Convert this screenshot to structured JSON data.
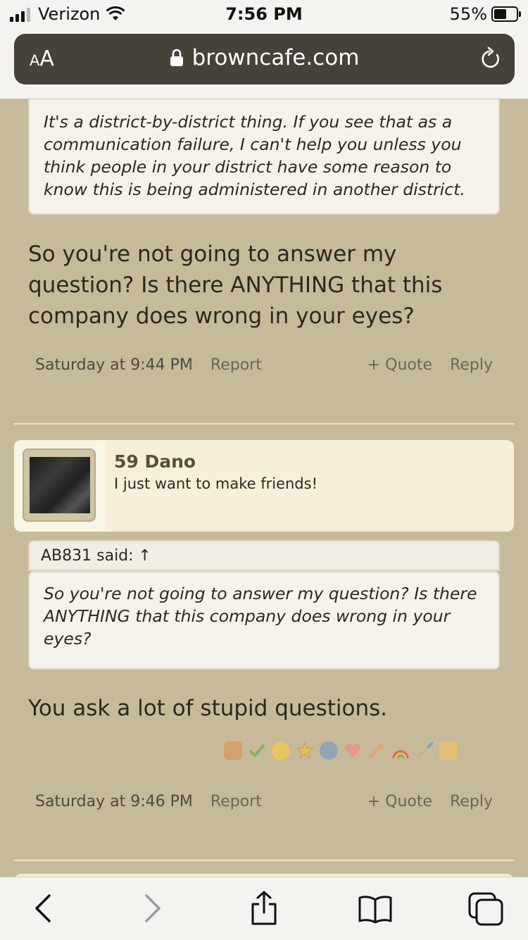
{
  "status_bar": {
    "carrier": "Verizon",
    "time": "7:56 PM",
    "battery": "55%",
    "battery_level": 0.55
  },
  "browser": {
    "text_size_small": "A",
    "text_size_large": "A",
    "url": "browncafe.com"
  },
  "posts": [
    {
      "quote_text": "It's a district-by-district thing. If you see that as a communication failure, I can't help you unless you think people in your district have some reason to know this is being administered in another district.",
      "body": "So you're not going to answer my question? Is there ANYTHING that this company does wrong in your eyes?",
      "timestamp": "Saturday at 9:44 PM",
      "report": "Report",
      "quote": "+ Quote",
      "reply": "Reply"
    },
    {
      "username": "59 Dano",
      "user_title": "I just want to make friends!",
      "quote_author": "AB831 said: ↑",
      "quote_text": "So you're not going to answer my question? Is there ANYTHING that this company does wrong in your eyes?",
      "body": "You ask a lot of stupid questions.",
      "timestamp": "Saturday at 9:46 PM",
      "report": "Report",
      "quote": "+ Quote",
      "reply": "Reply",
      "reactions": [
        "thumbs-up-icon",
        "checkmark-icon",
        "grin-icon",
        "star-badge-icon",
        "info-icon",
        "heart-icon",
        "wrench-icon",
        "rainbow-icon",
        "paintbrush-icon",
        "beer-mug-icon"
      ]
    }
  ],
  "colors": {
    "page_bg": "#c6ba9a",
    "post_header_bg": "#f7efd9",
    "username": "#5c5034"
  }
}
